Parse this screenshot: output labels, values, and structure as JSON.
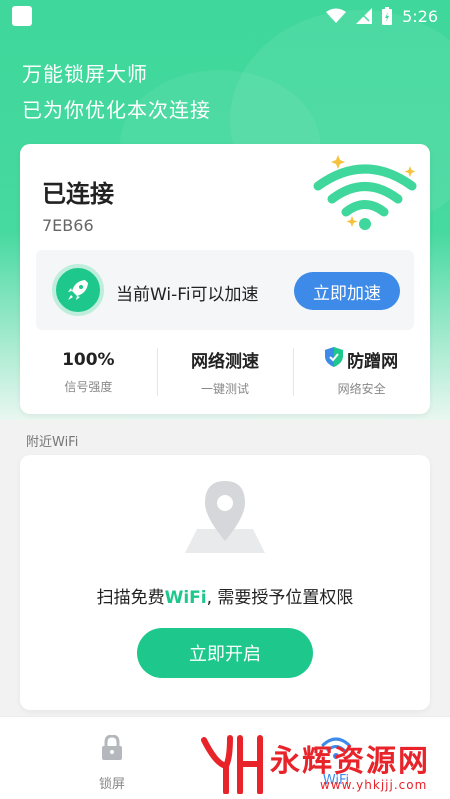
{
  "status_bar": {
    "time": "5:26"
  },
  "header": {
    "title": "万能锁屏大师",
    "subtitle": "已为你优化本次连接"
  },
  "connection": {
    "status": "已连接",
    "ssid": "7EB66",
    "speed_prompt": "当前Wi-Fi可以加速",
    "accelerate_label": "立即加速"
  },
  "stats": [
    {
      "value": "100%",
      "label": "信号强度"
    },
    {
      "value": "网络测速",
      "label": "一键测试"
    },
    {
      "value": "防蹭网",
      "label": "网络安全"
    }
  ],
  "nearby": {
    "section_label": "附近WiFi",
    "message_prefix": "扫描免费",
    "message_highlight": "WiFi",
    "message_suffix": ", 需要授予位置权限",
    "enable_label": "立即开启"
  },
  "bottom_nav": {
    "lock_label": "锁屏",
    "wifi_label": "WiFi"
  },
  "watermark": {
    "text": "永辉资源网",
    "url": "www.yhkjjj.com"
  },
  "colors": {
    "accent_green": "#1ec88c",
    "accent_blue": "#3d8ae8",
    "watermark_red": "#e8232a"
  }
}
